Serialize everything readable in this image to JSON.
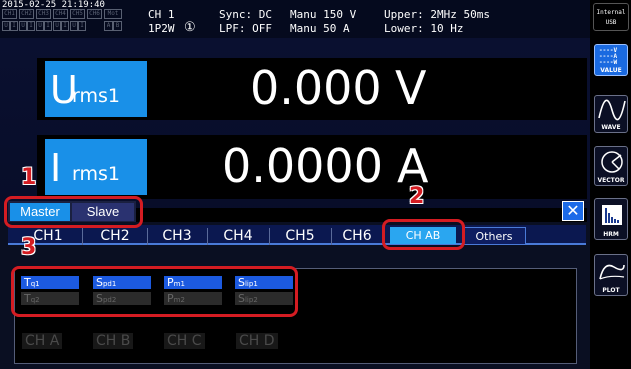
{
  "status": {
    "datetime": "2015-02-25 21:19:40",
    "ch_indicators_row1": [
      "CH1",
      "CH2",
      "CH3",
      "CH4",
      "CH5",
      "CH6",
      "Mot"
    ],
    "ch_indicators_row2": [
      "U",
      "I",
      "U",
      "I",
      "U",
      "I",
      "U",
      "I",
      "U",
      "I",
      "A",
      "B"
    ],
    "channel": "CH 1",
    "wiring": "1P2W",
    "wiring_mark": "①",
    "sync": "Sync: DC",
    "lpf": "LPF:  OFF",
    "range_u": "Manu 150 V",
    "range_i": "Manu  50 A",
    "upper": "Upper:  2MHz   50ms",
    "lower": "Lower: 10 Hz",
    "storage": "Internal",
    "storage_sub": "USB"
  },
  "measurements": [
    {
      "symbol": "U",
      "sub": "rms1",
      "value": "0.000",
      "unit": "V"
    },
    {
      "symbol": "I",
      "sub": "rms1",
      "value": "0.0000",
      "unit": "A"
    },
    {
      "symbol": "",
      "sub": "",
      "value": "",
      "unit": ""
    }
  ],
  "master_slave": {
    "master": "Master",
    "slave": "Slave",
    "selected": "Master"
  },
  "tabs": [
    {
      "label": "CH1"
    },
    {
      "label": "CH2"
    },
    {
      "label": "CH3"
    },
    {
      "label": "CH4"
    },
    {
      "label": "CH5"
    },
    {
      "label": "CH6"
    },
    {
      "label": "CH AB",
      "selected": true
    },
    {
      "label": "Others"
    }
  ],
  "params": {
    "row1": [
      {
        "main": "T",
        "sub": "q1"
      },
      {
        "main": "S",
        "sub": "pd1"
      },
      {
        "main": "P",
        "sub": "m1"
      },
      {
        "main": "S",
        "sub": "lip1"
      }
    ],
    "row2": [
      {
        "main": "T",
        "sub": "q2"
      },
      {
        "main": "S",
        "sub": "pd2"
      },
      {
        "main": "P",
        "sub": "m2"
      },
      {
        "main": "S",
        "sub": "lip2"
      }
    ]
  },
  "channel_buttons": [
    "CH  A",
    "CH  B",
    "CH  C",
    "CH  D"
  ],
  "close_button": "✕",
  "right_menu": [
    {
      "label": "VALUE",
      "icon": "value-icon",
      "active": true
    },
    {
      "label": "WAVE",
      "icon": "wave-icon"
    },
    {
      "label": "VECTOR",
      "icon": "vector-icon"
    },
    {
      "label": "HRM",
      "icon": "hrm-icon"
    },
    {
      "label": "PLOT",
      "icon": "plot-icon"
    }
  ],
  "value_icon_rows": [
    "V",
    "A",
    "W"
  ],
  "callouts": [
    "1",
    "2",
    "3"
  ],
  "colors": {
    "accent": "#1990e8",
    "callout": "#d41c22",
    "param_on": "#1c5ae0",
    "tab_selected": "#2aa6f0"
  }
}
